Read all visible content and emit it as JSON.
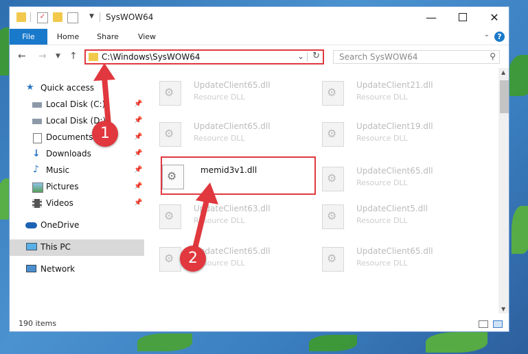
{
  "window": {
    "title": "SysWOW64"
  },
  "ribbon": {
    "tabs": [
      "File",
      "Home",
      "Share",
      "View"
    ],
    "help": "?"
  },
  "nav": {
    "address": "C:\\Windows\\SysWOW64",
    "search_placeholder": "Search SysWOW64"
  },
  "sidebar": {
    "items": [
      {
        "label": "Quick access",
        "icon": "star-icon"
      },
      {
        "label": "Local Disk (C:)",
        "icon": "drive-icon"
      },
      {
        "label": "Local Disk (D:)",
        "icon": "drive-icon"
      },
      {
        "label": "Documents",
        "icon": "documents-icon"
      },
      {
        "label": "Downloads",
        "icon": "download-arrow-icon"
      },
      {
        "label": "Music",
        "icon": "music-note-icon"
      },
      {
        "label": "Pictures",
        "icon": "pictures-icon"
      },
      {
        "label": "Videos",
        "icon": "film-icon"
      },
      {
        "label": "OneDrive",
        "icon": "cloud-icon"
      },
      {
        "label": "This PC",
        "icon": "monitor-icon"
      },
      {
        "label": "Network",
        "icon": "network-icon"
      }
    ]
  },
  "files": [
    {
      "name": "UpdateClient65.dll",
      "type": "Resource DLL"
    },
    {
      "name": "UpdateClient21.dll",
      "type": "Resource DLL"
    },
    {
      "name": "UpdateClient65.dll",
      "type": "Resource DLL"
    },
    {
      "name": "UpdateClient19.dll",
      "type": "Resource DLL"
    },
    {
      "name": "memid3v1.dll",
      "type": ""
    },
    {
      "name": "UpdateClient65.dll",
      "type": "Resource DLL"
    },
    {
      "name": "UpdateClient63.dll",
      "type": "Resource DLL"
    },
    {
      "name": "UpdateClient5.dll",
      "type": "Resource DLL"
    },
    {
      "name": "UpdateClient65.dll",
      "type": "Resource DLL"
    },
    {
      "name": "UpdateClient65.dll",
      "type": "Resource DLL"
    }
  ],
  "status": {
    "item_count": "190 items"
  },
  "annotations": {
    "step1": "1",
    "step2": "2",
    "color": "#e0383e"
  }
}
